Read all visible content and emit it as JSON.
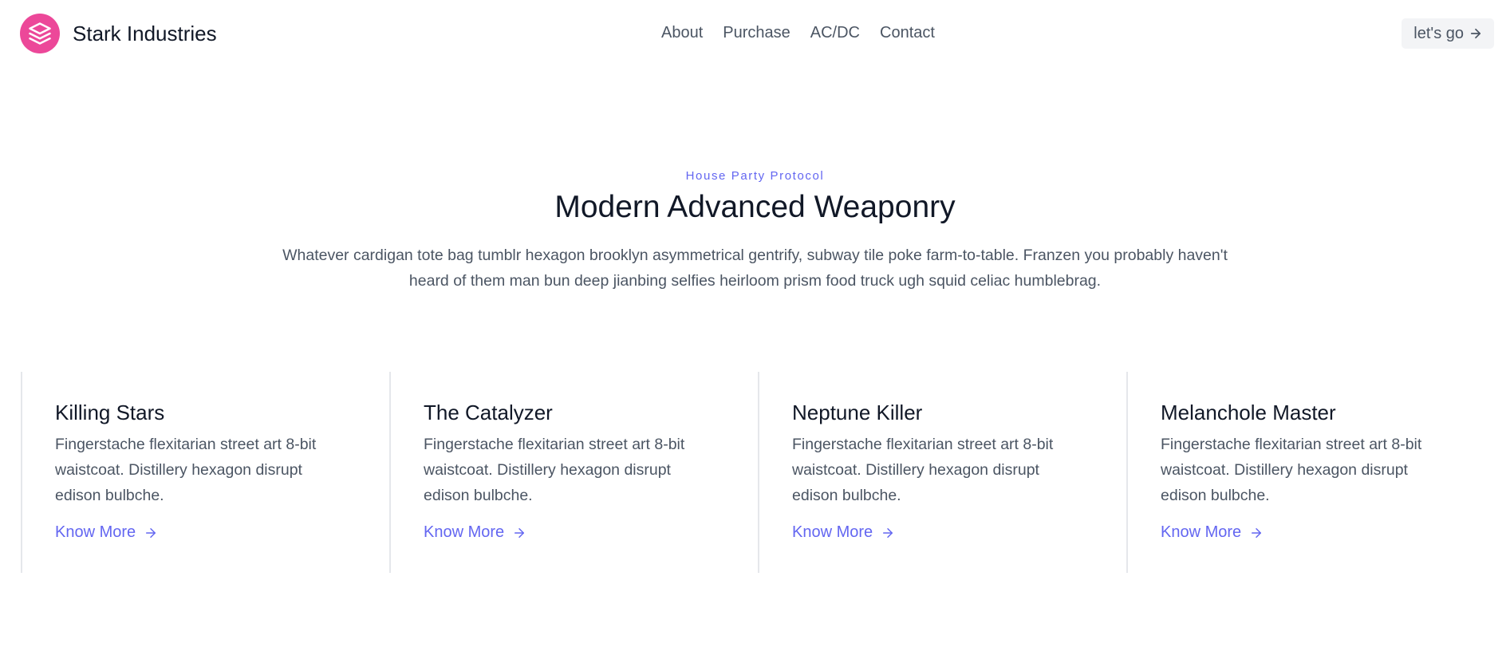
{
  "header": {
    "brand_name": "Stark Industries",
    "logo_icon": "layers-icon",
    "nav": [
      "About",
      "Purchase",
      "AC/DC",
      "Contact"
    ],
    "cta_label": "let's go",
    "cta_icon": "arrow-right-icon"
  },
  "hero": {
    "eyebrow": "House Party Protocol",
    "title": "Modern Advanced Weaponry",
    "description": "Whatever cardigan tote bag tumblr hexagon brooklyn asymmetrical gentrify, subway tile poke farm-to-table. Franzen you probably haven't heard of them man bun deep jianbing selfies heirloom prism food truck ugh squid celiac humblebrag."
  },
  "cards": [
    {
      "title": "Killing Stars",
      "text": "Fingerstache flexitarian street art 8-bit waistcoat. Distillery hexagon disrupt edison bulbche.",
      "link_label": "Know More"
    },
    {
      "title": "The Catalyzer",
      "text": "Fingerstache flexitarian street art 8-bit waistcoat. Distillery hexagon disrupt edison bulbche.",
      "link_label": "Know More"
    },
    {
      "title": "Neptune Killer",
      "text": "Fingerstache flexitarian street art 8-bit waistcoat. Distillery hexagon disrupt edison bulbche.",
      "link_label": "Know More"
    },
    {
      "title": "Melanchole Master",
      "text": "Fingerstache flexitarian street art 8-bit waistcoat. Distillery hexagon disrupt edison bulbche.",
      "link_label": "Know More"
    }
  ],
  "colors": {
    "brand": "#ec4899",
    "accent": "#6366f1",
    "heading": "#111827",
    "body": "#4b5563",
    "divider": "#e5e7eb",
    "button_bg": "#f3f4f6"
  }
}
